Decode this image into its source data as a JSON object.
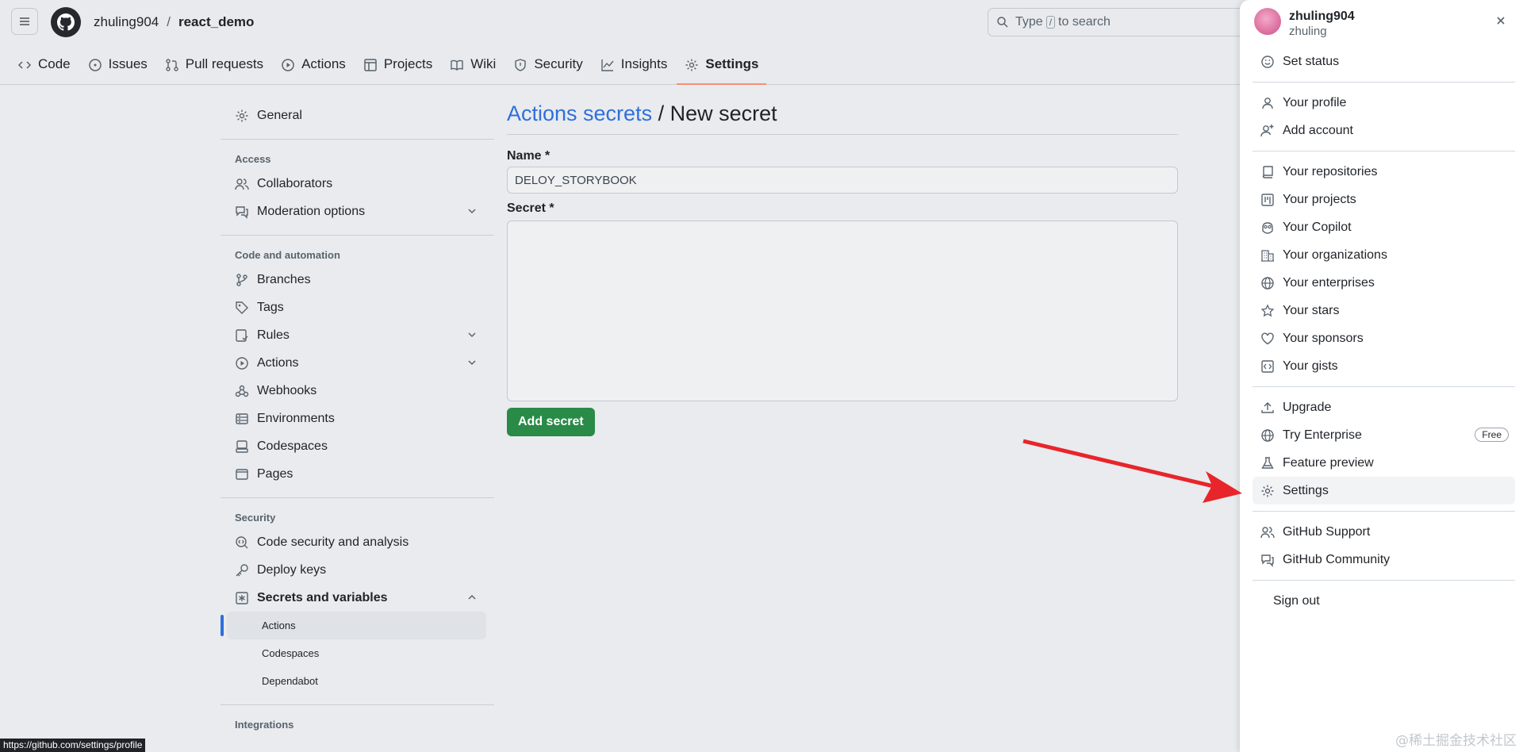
{
  "header": {
    "owner": "zhuling904",
    "separator": "/",
    "repo": "react_demo",
    "search_prefix": "Type",
    "search_key": "/",
    "search_suffix": "to search"
  },
  "tabs": [
    {
      "label": "Code",
      "icon": "code-icon"
    },
    {
      "label": "Issues",
      "icon": "issue-icon"
    },
    {
      "label": "Pull requests",
      "icon": "pull-request-icon"
    },
    {
      "label": "Actions",
      "icon": "play-icon"
    },
    {
      "label": "Projects",
      "icon": "table-icon"
    },
    {
      "label": "Wiki",
      "icon": "book-icon"
    },
    {
      "label": "Security",
      "icon": "shield-icon"
    },
    {
      "label": "Insights",
      "icon": "graph-icon"
    },
    {
      "label": "Settings",
      "icon": "gear-icon",
      "active": true
    }
  ],
  "sidebar": {
    "general": "General",
    "access_heading": "Access",
    "collaborators": "Collaborators",
    "moderation": "Moderation options",
    "code_heading": "Code and automation",
    "branches": "Branches",
    "tags": "Tags",
    "rules": "Rules",
    "actions": "Actions",
    "webhooks": "Webhooks",
    "environments": "Environments",
    "codespaces": "Codespaces",
    "pages": "Pages",
    "security_heading": "Security",
    "code_security": "Code security and analysis",
    "deploy_keys": "Deploy keys",
    "secrets": "Secrets and variables",
    "sub_actions": "Actions",
    "sub_codespaces": "Codespaces",
    "sub_dependabot": "Dependabot",
    "integrations_heading": "Integrations"
  },
  "main": {
    "title_link": "Actions secrets",
    "title_rest": " / New secret",
    "name_label": "Name *",
    "name_value": "DELOY_STORYBOOK",
    "secret_label": "Secret *",
    "add_button": "Add secret"
  },
  "status_url": "https://github.com/settings/profile",
  "panel": {
    "username": "zhuling904",
    "login": "zhuling",
    "set_status": "Set status",
    "your_profile": "Your profile",
    "add_account": "Add account",
    "your_repositories": "Your repositories",
    "your_projects": "Your projects",
    "your_copilot": "Your Copilot",
    "your_organizations": "Your organizations",
    "your_enterprises": "Your enterprises",
    "your_stars": "Your stars",
    "your_sponsors": "Your sponsors",
    "your_gists": "Your gists",
    "upgrade": "Upgrade",
    "try_enterprise": "Try Enterprise",
    "free_badge": "Free",
    "feature_preview": "Feature preview",
    "settings": "Settings",
    "github_support": "GitHub Support",
    "github_community": "GitHub Community",
    "sign_out": "Sign out"
  },
  "watermark": "@稀土掘金技术社区",
  "colors": {
    "accent": "#2f6fdc",
    "primary_button": "#2a8a48",
    "arrow": "#e8252b",
    "active_tab_underline": "#fd8c73"
  }
}
